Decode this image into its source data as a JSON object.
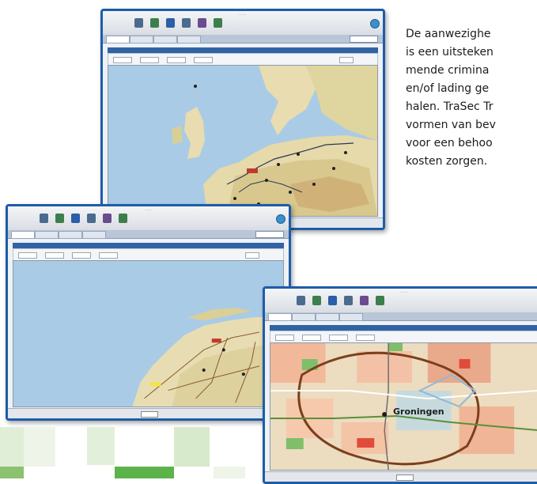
{
  "description": {
    "lines": [
      "De aanwezighe",
      "is een uitsteken",
      "mende crimina",
      "en/of lading ge",
      "halen. TraSec Tr",
      "vormen van bev",
      "voor een behoo",
      "kosten zorgen."
    ]
  },
  "screens": {
    "europe": {
      "city_label": "",
      "map_kind": "europe"
    },
    "netherlands": {
      "city_label": "",
      "map_kind": "netherlands"
    },
    "groningen": {
      "city_label": "Groningen",
      "map_kind": "city"
    }
  },
  "colors": {
    "window_border": "#1d5da8",
    "sea": "#a9cbe6",
    "land": "#e8dcb0",
    "accent_green": "#5cb34a"
  }
}
